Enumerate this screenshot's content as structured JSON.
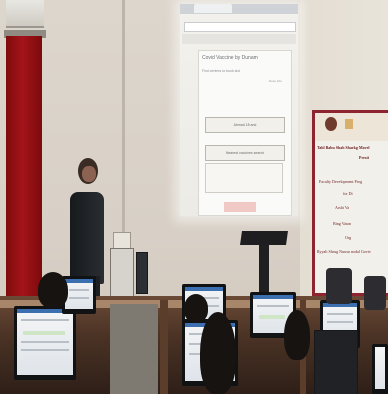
{
  "projection": {
    "page_title": "Covid Vaccine by Dunam",
    "subtitle": "Find centres to book slot",
    "small_label": "Dose Info",
    "option_1": "Ahmad 18 and",
    "option_2": "Nearest vaccines search"
  },
  "banner": {
    "line_1": "Tahl Babu Shah Sharkg Mavel",
    "line_2": "Presti",
    "line_3": "Faculty Development Prog",
    "line_4": "for Di",
    "line_5": "Arshi Va",
    "line_6": "Bing Vatan",
    "line_7": "Org",
    "line_8": "Ryyali Shrug Nusrar nodal Govtv"
  },
  "colors": {
    "curtain": "#a3141a",
    "banner_border": "#8d2430",
    "wall": "#ddd6cc",
    "desk": "#6b4a36"
  }
}
